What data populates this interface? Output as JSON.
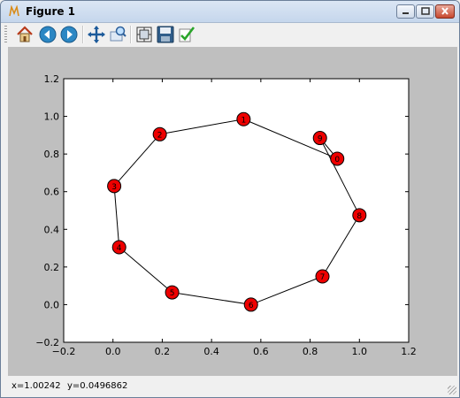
{
  "window": {
    "title": "Figure 1"
  },
  "toolbar": {
    "buttons": [
      {
        "icon": "home-icon"
      },
      {
        "icon": "back-icon"
      },
      {
        "icon": "forward-icon"
      },
      {
        "icon": "pan-icon"
      },
      {
        "icon": "zoom-icon"
      },
      {
        "icon": "subplots-icon"
      },
      {
        "icon": "save-icon"
      },
      {
        "icon": "edit-icon"
      }
    ]
  },
  "status": {
    "x": "x=1.00242",
    "y": "y=0.0496862"
  },
  "colors": {
    "node_fill": "#ee0000",
    "canvas_bg": "#bfbfbf",
    "axes_bg": "#ffffff"
  },
  "chart_data": {
    "type": "scatter",
    "title": "",
    "xlabel": "",
    "ylabel": "",
    "xlim": [
      -0.2,
      1.2
    ],
    "ylim": [
      -0.2,
      1.2
    ],
    "xticks": [
      "−0.2",
      "0.0",
      "0.2",
      "0.4",
      "0.6",
      "0.8",
      "1.0",
      "1.2"
    ],
    "yticks": [
      "−0.2",
      "0.0",
      "0.2",
      "0.4",
      "0.6",
      "0.8",
      "1.0",
      "1.2"
    ],
    "xtick_values": [
      -0.2,
      0,
      0.2,
      0.4,
      0.6,
      0.8,
      1.0,
      1.2
    ],
    "ytick_values": [
      -0.2,
      0,
      0.2,
      0.4,
      0.6,
      0.8,
      1.0,
      1.2
    ],
    "nodes": [
      {
        "label": "0",
        "x": 0.91,
        "y": 0.775
      },
      {
        "label": "1",
        "x": 0.53,
        "y": 0.985
      },
      {
        "label": "2",
        "x": 0.19,
        "y": 0.905
      },
      {
        "label": "3",
        "x": 0.005,
        "y": 0.63
      },
      {
        "label": "4",
        "x": 0.025,
        "y": 0.305
      },
      {
        "label": "5",
        "x": 0.24,
        "y": 0.065
      },
      {
        "label": "6",
        "x": 0.56,
        "y": 0.0
      },
      {
        "label": "7",
        "x": 0.85,
        "y": 0.15
      },
      {
        "label": "8",
        "x": 1.0,
        "y": 0.475
      },
      {
        "label": "9",
        "x": 0.84,
        "y": 0.885
      }
    ],
    "edges": [
      [
        1,
        2
      ],
      [
        2,
        3
      ],
      [
        3,
        4
      ],
      [
        4,
        5
      ],
      [
        5,
        6
      ],
      [
        6,
        7
      ],
      [
        7,
        8
      ],
      [
        8,
        9
      ],
      [
        9,
        0
      ],
      [
        0,
        1
      ]
    ]
  }
}
